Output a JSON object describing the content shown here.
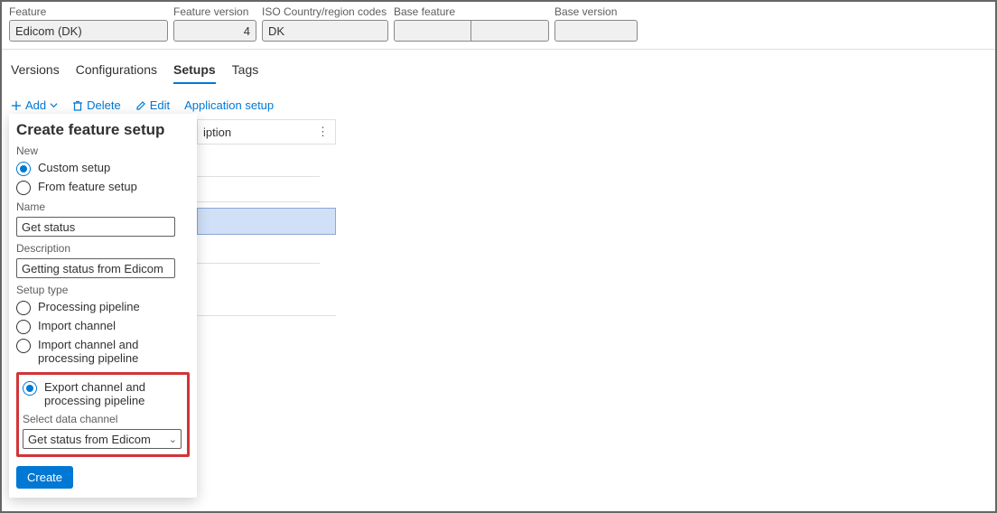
{
  "header": {
    "feature_label": "Feature",
    "feature_value": "Edicom (DK)",
    "feature_version_label": "Feature version",
    "feature_version_value": "4",
    "iso_label": "ISO Country/region codes",
    "iso_value": "DK",
    "base_feature_label": "Base feature",
    "base_feature_value": "",
    "base_feature_value2": "",
    "base_version_label": "Base version",
    "base_version_value": ""
  },
  "tabs": {
    "versions": "Versions",
    "configurations": "Configurations",
    "setups": "Setups",
    "tags": "Tags"
  },
  "toolbar": {
    "add": "Add",
    "delete": "Delete",
    "edit": "Edit",
    "app_setup": "Application setup"
  },
  "grid": {
    "col1": "iption"
  },
  "panel": {
    "title": "Create feature setup",
    "new_label": "New",
    "radio_custom": "Custom setup",
    "radio_feature": "From feature setup",
    "name_label": "Name",
    "name_value": "Get status",
    "desc_label": "Description",
    "desc_value": "Getting status from Edicom",
    "setup_type_label": "Setup type",
    "radio_proc": "Processing pipeline",
    "radio_import": "Import channel",
    "radio_import_proc": "Import channel and processing pipeline",
    "radio_export_proc": "Export channel and processing pipeline",
    "select_channel_label": "Select data channel",
    "select_channel_value": "Get status from Edicom",
    "create": "Create"
  }
}
